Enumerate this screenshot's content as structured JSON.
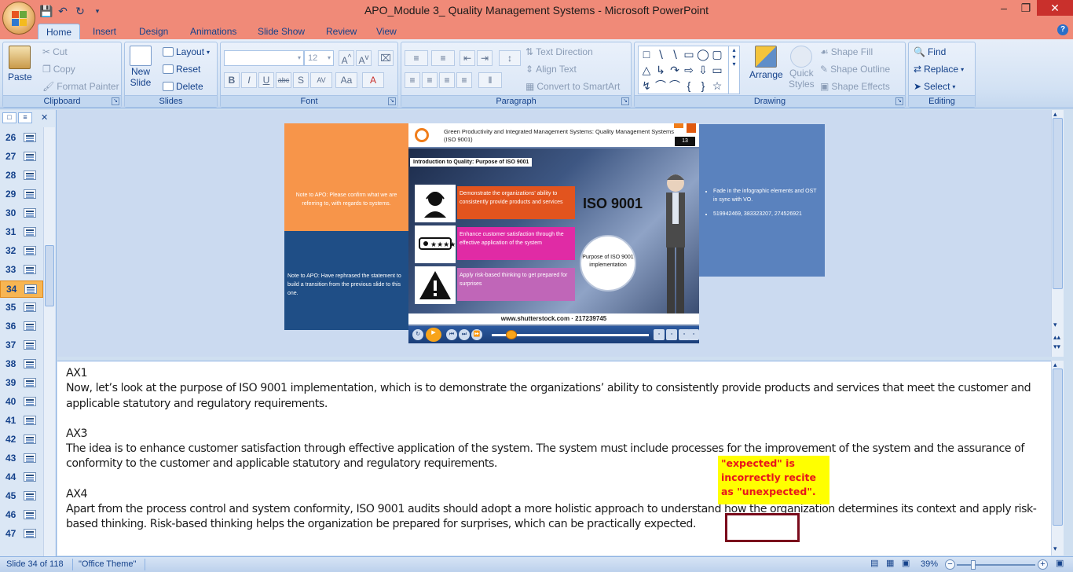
{
  "window": {
    "title": "APO_Module 3_ Quality Management Systems - Microsoft PowerPoint"
  },
  "tabs": [
    "Home",
    "Insert",
    "Design",
    "Animations",
    "Slide Show",
    "Review",
    "View"
  ],
  "ribbon": {
    "clipboard": {
      "label": "Clipboard",
      "paste": "Paste",
      "cut": "Cut",
      "copy": "Copy",
      "format_painter": "Format Painter"
    },
    "slides": {
      "label": "Slides",
      "new_slide_1": "New",
      "new_slide_2": "Slide",
      "layout": "Layout",
      "reset": "Reset",
      "delete": "Delete"
    },
    "font": {
      "label": "Font",
      "size": "12"
    },
    "paragraph": {
      "label": "Paragraph",
      "text_direction": "Text Direction",
      "align_text": "Align Text",
      "convert_smartart": "Convert to SmartArt"
    },
    "drawing": {
      "label": "Drawing",
      "arrange": "Arrange",
      "quick_styles_1": "Quick",
      "quick_styles_2": "Styles",
      "shape_fill": "Shape Fill",
      "shape_outline": "Shape Outline",
      "shape_effects": "Shape Effects"
    },
    "editing": {
      "label": "Editing",
      "find": "Find",
      "replace": "Replace",
      "select": "Select"
    }
  },
  "slide_panel": {
    "items": [
      {
        "num": "26",
        "active": false
      },
      {
        "num": "27",
        "active": false
      },
      {
        "num": "28",
        "active": false
      },
      {
        "num": "29",
        "active": false
      },
      {
        "num": "30",
        "active": false
      },
      {
        "num": "31",
        "active": false
      },
      {
        "num": "32",
        "active": false
      },
      {
        "num": "33",
        "active": false
      },
      {
        "num": "34",
        "active": true
      },
      {
        "num": "35",
        "active": false
      },
      {
        "num": "36",
        "active": false
      },
      {
        "num": "37",
        "active": false
      },
      {
        "num": "38",
        "active": false
      },
      {
        "num": "39",
        "active": false
      },
      {
        "num": "40",
        "active": false
      },
      {
        "num": "41",
        "active": false
      },
      {
        "num": "42",
        "active": false
      },
      {
        "num": "43",
        "active": false
      },
      {
        "num": "44",
        "active": false
      },
      {
        "num": "45",
        "active": false
      },
      {
        "num": "46",
        "active": false
      },
      {
        "num": "47",
        "active": false
      }
    ]
  },
  "slide": {
    "orange_note": "Note to APO: Please confirm what we are referring to, with regards to systems.",
    "blue_note": "Note to APO: Have rephrased the statement to build a transition from the previous slide to this one.",
    "right_notes": [
      "Fade in the infographic elements and OST in sync with VO.",
      "519942469, 383323207, 274526921"
    ],
    "header_text": "Green Productivity and Integrated Management Systems: Quality Management Systems (ISO 9001)",
    "page_num": "13",
    "intro_label": "Introduction to Quality:  Purpose of ISO 9001",
    "items": [
      "Demonstrate the organizations' ability to consistently provide products and services",
      "Enhance customer satisfaction through the effective application of the system",
      "Apply risk-based thinking to get prepared for surprises"
    ],
    "iso_title": "ISO 9001",
    "circle_text": "Purpose of ISO 9001 implementation",
    "watermark": "www.shutterstock.com · 217239745"
  },
  "notes": {
    "p1_tag": "AX1",
    "p1": "Now, let’s look at the purpose of ISO 9001 implementation, which is to demonstrate the organizations’ ability to consistently provide products and services that meet the customer and applicable statutory and regulatory requirements.",
    "p2_tag": "AX3",
    "p2": "The idea is to enhance customer satisfaction through effective application of the system. The system must include processes for the improvement of the system and the assurance of conformity to the customer and applicable statutory and regulatory requirements.",
    "p3_tag": "AX4",
    "p3": "Apart from the process control and system conformity, ISO 9001 audits should adopt a more holistic approach to understand how the organization determines its context and apply risk-based thinking. Risk-based thinking helps the organization be prepared for surprises, which can be practically expected."
  },
  "annotation": {
    "text": "\"expected\" is incorrectly recite as \"unexpected\"."
  },
  "status": {
    "slide": "Slide 34 of 118",
    "theme": "\"Office Theme\"",
    "zoom": "39%"
  },
  "colors": {
    "title_bar": "#f08a78",
    "accent_orange": "#f7954a",
    "accent_blue": "#1f4e86",
    "annotation_yellow": "#ffff00",
    "annotation_red": "#e8151b",
    "annotation_box": "#7a0b1c"
  }
}
